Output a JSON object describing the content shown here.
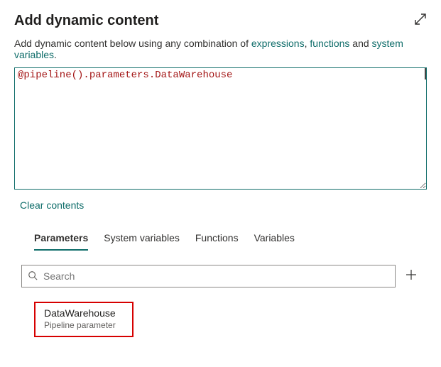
{
  "header": {
    "title": "Add dynamic content"
  },
  "intro": {
    "prefix": "Add dynamic content below using any combination of ",
    "link_expressions": "expressions",
    "sep1": ", ",
    "link_functions": "functions",
    "sep2": " and ",
    "link_sysvars": "system variables",
    "suffix": "."
  },
  "editor": {
    "value": "@pipeline().parameters.DataWarehouse"
  },
  "actions": {
    "clear": "Clear contents"
  },
  "tabs": {
    "parameters": "Parameters",
    "system_variables": "System variables",
    "functions": "Functions",
    "variables": "Variables"
  },
  "search": {
    "placeholder": "Search"
  },
  "param": {
    "name": "DataWarehouse",
    "subtitle": "Pipeline parameter"
  }
}
